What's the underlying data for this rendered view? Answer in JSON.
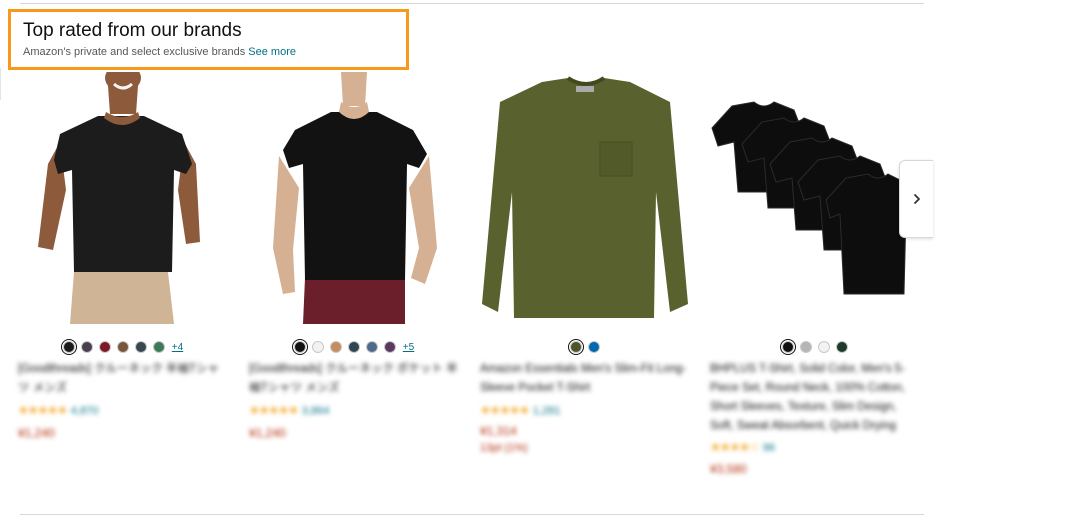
{
  "header": {
    "title": "Top rated from our brands",
    "subtitle": "Amazon's private and select exclusive brands",
    "see_more": "See more"
  },
  "products": [
    {
      "swatches": [
        "#1a1a1a",
        "#4a3f4f",
        "#7d1a26",
        "#7a553a",
        "#37474f",
        "#3c7a5a"
      ],
      "more_colors": "+4",
      "title": "[Goodthreads] クルーネック 半袖Tシャツ メンズ",
      "stars": "★★★★★",
      "reviews": "4,870",
      "price": "¥1,240",
      "points": ""
    },
    {
      "swatches": [
        "#111111",
        "#f2f2f2",
        "#c38d5d",
        "#2f4650",
        "#4f6a8a",
        "#5b3a5e"
      ],
      "more_colors": "+5",
      "title": "[Goodthreads] クルーネック ポケット 半袖Tシャツ メンズ",
      "stars": "★★★★★",
      "reviews": "3,864",
      "price": "¥1,240",
      "points": ""
    },
    {
      "swatches": [
        "#4f5528",
        "#0069b4"
      ],
      "more_colors": "",
      "title": "Amazon Essentials Men's Slim-Fit Long-Sleeve Pocket T-Shirt",
      "stars": "★★★★★",
      "reviews": "1,281",
      "price": "¥1,314",
      "points": "13pt (1%)"
    },
    {
      "swatches": [
        "#111111",
        "#b5b5b5",
        "#f2f2f2",
        "#1d3a2a"
      ],
      "more_colors": "",
      "title": "BHPLUS T-Shirt, Solid Color, Men's 5-Piece Set, Round Neck, 100% Cotton, Short Sleeves, Texture, Slim Design, Soft, Sweat Absorbent, Quick Drying",
      "stars": "★★★★☆",
      "reviews": "96",
      "price": "¥3,580",
      "points": ""
    }
  ],
  "colors": {
    "accent_orange": "#f79a1b",
    "link": "#007185",
    "price": "#b12704",
    "star": "#f4a41d"
  },
  "icons": {
    "next": "chevron-right-icon"
  }
}
